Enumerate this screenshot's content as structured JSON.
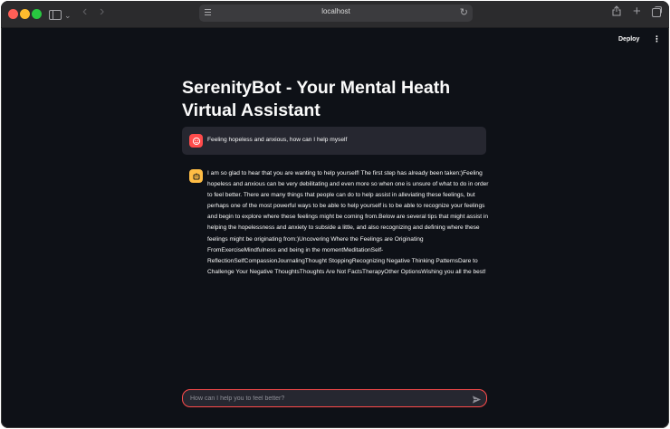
{
  "browser": {
    "url": "localhost"
  },
  "header": {
    "deploy_label": "Deploy",
    "menu_glyph": "⋮"
  },
  "main": {
    "title": "SerenityBot - Your Mental Heath Virtual Assistant",
    "messages": [
      {
        "role": "user",
        "avatar_icon": "user-avatar-icon",
        "text": "Feeling hopeless and anxious, how can I help myself"
      },
      {
        "role": "assistant",
        "avatar_icon": "bot-avatar-icon",
        "text": "I am so glad to hear that you are wanting to help yourself! The first step has already been taken:)Feeling hopeless and anxious can be very debilitating and even more so when one is unsure of what to do in order to feel better. There are many things that people can do to help assist in alleviating these feelings, but perhaps one of the most powerful ways to be able to help yourself is to be able to recognize your feelings and begin to explore where these feelings might be coming from.Below are several tips that might assist in helping the hopelessness and anxiety to subside a little, and also recognizing and defining where these feelings might be originating from:)Uncovering Where the Feelings are Originating FromExerciseMindfulness and being in the momentMeditationSelf-ReflectionSelfCompassionJournalingThought StoppingRecognizing Negative Thinking PatternsDare to Challenge Your Negative ThoughtsThoughts Are Not FactsTherapyOther OptionsWishing you all the best!"
      }
    ]
  },
  "chat_input": {
    "placeholder": "How can I help you to feel better?",
    "value": ""
  },
  "colors": {
    "background": "#0e1117",
    "accent": "#ff4b4b",
    "bot_avatar": "#ffbd45",
    "user_bubble": "#262730"
  }
}
